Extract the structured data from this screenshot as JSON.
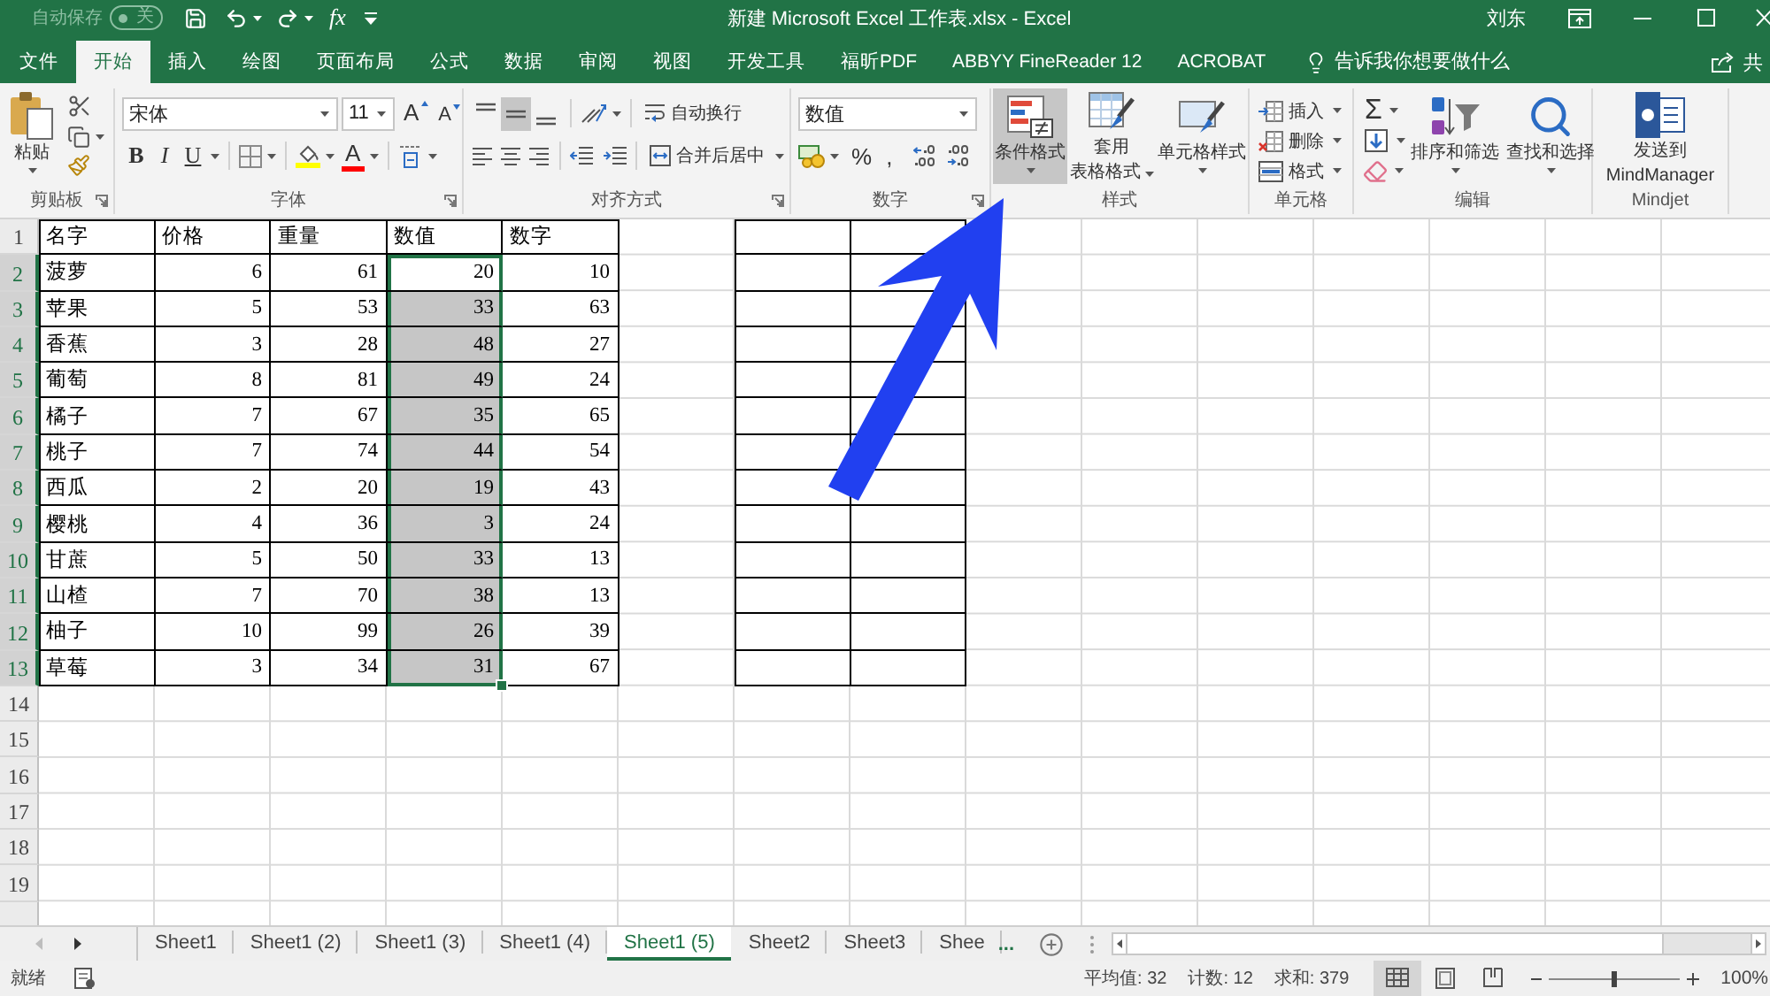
{
  "quick_access": {
    "autosave_label": "自动保存",
    "autosave_switch": {
      "label": "关",
      "on": false
    },
    "function_button": "fx"
  },
  "window": {
    "title": "新建 Microsoft Excel 工作表.xlsx - Excel",
    "user": "刘东"
  },
  "ribbon_tabs": [
    {
      "label": "文件",
      "selected": false
    },
    {
      "label": "开始",
      "selected": true
    },
    {
      "label": "插入",
      "selected": false
    },
    {
      "label": "绘图",
      "selected": false
    },
    {
      "label": "页面布局",
      "selected": false
    },
    {
      "label": "公式",
      "selected": false
    },
    {
      "label": "数据",
      "selected": false
    },
    {
      "label": "审阅",
      "selected": false
    },
    {
      "label": "视图",
      "selected": false
    },
    {
      "label": "开发工具",
      "selected": false
    },
    {
      "label": "福昕PDF",
      "selected": false
    },
    {
      "label": "ABBYY FineReader 12",
      "selected": false
    },
    {
      "label": "ACROBAT",
      "selected": false
    }
  ],
  "tell_me": {
    "placeholder": "告诉我你想要做什么"
  },
  "share": {
    "label": "共"
  },
  "ribbon": {
    "clipboard": {
      "label": "剪贴板",
      "paste": "粘贴"
    },
    "font": {
      "label": "字体",
      "font_name": "宋体",
      "font_size": "11",
      "grow": "A",
      "shrink": "A",
      "styles": [
        "B",
        "I",
        "U"
      ],
      "font_color": "A"
    },
    "alignment": {
      "label": "对齐方式",
      "vertical": [
        {
          "kind": "top",
          "selected": false
        },
        {
          "kind": "middle",
          "selected": true
        },
        {
          "kind": "bottom",
          "selected": false
        }
      ],
      "wrap_text": "自动换行",
      "merge_center": "合并后居中"
    },
    "number": {
      "label": "数字",
      "format": "数值",
      "percent": "%",
      "comma": ","
    },
    "styles": {
      "label": "样式",
      "buttons": [
        {
          "kind": "conditional",
          "lines": [
            "条件格式"
          ],
          "selected": true
        },
        {
          "kind": "table",
          "lines": [
            "套用",
            "表格格式"
          ],
          "selected": false
        },
        {
          "kind": "cell",
          "lines": [
            "单元格样式"
          ],
          "selected": false
        }
      ]
    },
    "cells": {
      "label": "单元格",
      "buttons": [
        {
          "kind": "insert",
          "label": "插入"
        },
        {
          "kind": "delete",
          "label": "删除"
        },
        {
          "kind": "format",
          "label": "格式"
        }
      ]
    },
    "editing": {
      "label": "编辑",
      "autosum": "Σ",
      "buttons": [
        {
          "kind": "sort",
          "label": "排序和筛选"
        },
        {
          "kind": "find",
          "label": "查找和选择"
        }
      ]
    },
    "mindjet": {
      "label": "Mindjet",
      "lines": [
        "发送到",
        "MindManager"
      ]
    }
  },
  "sheet": {
    "bordered_blank_range": true,
    "rows": [
      {
        "number": "1",
        "selected": false,
        "cells": [
          {
            "kind": "text",
            "text": "名字",
            "selected": false,
            "active": false
          },
          {
            "kind": "text",
            "text": "价格",
            "selected": false,
            "active": false
          },
          {
            "kind": "text",
            "text": "重量",
            "selected": false,
            "active": false
          },
          {
            "kind": "text",
            "text": "数值",
            "selected": false,
            "active": false
          },
          {
            "kind": "text",
            "text": "数字",
            "selected": false,
            "active": false
          }
        ]
      },
      {
        "number": "2",
        "selected": true,
        "cells": [
          {
            "kind": "text",
            "text": "菠萝",
            "selected": false,
            "active": false
          },
          {
            "kind": "number",
            "text": "6",
            "selected": false,
            "active": false
          },
          {
            "kind": "number",
            "text": "61",
            "selected": false,
            "active": false
          },
          {
            "kind": "number",
            "text": "20",
            "selected": true,
            "active": true
          },
          {
            "kind": "number",
            "text": "10",
            "selected": false,
            "active": false
          }
        ]
      },
      {
        "number": "3",
        "selected": true,
        "cells": [
          {
            "kind": "text",
            "text": "苹果",
            "selected": false,
            "active": false
          },
          {
            "kind": "number",
            "text": "5",
            "selected": false,
            "active": false
          },
          {
            "kind": "number",
            "text": "53",
            "selected": false,
            "active": false
          },
          {
            "kind": "number",
            "text": "33",
            "selected": true,
            "active": false
          },
          {
            "kind": "number",
            "text": "63",
            "selected": false,
            "active": false
          }
        ]
      },
      {
        "number": "4",
        "selected": true,
        "cells": [
          {
            "kind": "text",
            "text": "香蕉",
            "selected": false,
            "active": false
          },
          {
            "kind": "number",
            "text": "3",
            "selected": false,
            "active": false
          },
          {
            "kind": "number",
            "text": "28",
            "selected": false,
            "active": false
          },
          {
            "kind": "number",
            "text": "48",
            "selected": true,
            "active": false
          },
          {
            "kind": "number",
            "text": "27",
            "selected": false,
            "active": false
          }
        ]
      },
      {
        "number": "5",
        "selected": true,
        "cells": [
          {
            "kind": "text",
            "text": "葡萄",
            "selected": false,
            "active": false
          },
          {
            "kind": "number",
            "text": "8",
            "selected": false,
            "active": false
          },
          {
            "kind": "number",
            "text": "81",
            "selected": false,
            "active": false
          },
          {
            "kind": "number",
            "text": "49",
            "selected": true,
            "active": false
          },
          {
            "kind": "number",
            "text": "24",
            "selected": false,
            "active": false
          }
        ]
      },
      {
        "number": "6",
        "selected": true,
        "cells": [
          {
            "kind": "text",
            "text": "橘子",
            "selected": false,
            "active": false
          },
          {
            "kind": "number",
            "text": "7",
            "selected": false,
            "active": false
          },
          {
            "kind": "number",
            "text": "67",
            "selected": false,
            "active": false
          },
          {
            "kind": "number",
            "text": "35",
            "selected": true,
            "active": false
          },
          {
            "kind": "number",
            "text": "65",
            "selected": false,
            "active": false
          }
        ]
      },
      {
        "number": "7",
        "selected": true,
        "cells": [
          {
            "kind": "text",
            "text": "桃子",
            "selected": false,
            "active": false
          },
          {
            "kind": "number",
            "text": "7",
            "selected": false,
            "active": false
          },
          {
            "kind": "number",
            "text": "74",
            "selected": false,
            "active": false
          },
          {
            "kind": "number",
            "text": "44",
            "selected": true,
            "active": false
          },
          {
            "kind": "number",
            "text": "54",
            "selected": false,
            "active": false
          }
        ]
      },
      {
        "number": "8",
        "selected": true,
        "cells": [
          {
            "kind": "text",
            "text": "西瓜",
            "selected": false,
            "active": false
          },
          {
            "kind": "number",
            "text": "2",
            "selected": false,
            "active": false
          },
          {
            "kind": "number",
            "text": "20",
            "selected": false,
            "active": false
          },
          {
            "kind": "number",
            "text": "19",
            "selected": true,
            "active": false
          },
          {
            "kind": "number",
            "text": "43",
            "selected": false,
            "active": false
          }
        ]
      },
      {
        "number": "9",
        "selected": true,
        "cells": [
          {
            "kind": "text",
            "text": "樱桃",
            "selected": false,
            "active": false
          },
          {
            "kind": "number",
            "text": "4",
            "selected": false,
            "active": false
          },
          {
            "kind": "number",
            "text": "36",
            "selected": false,
            "active": false
          },
          {
            "kind": "number",
            "text": "3",
            "selected": true,
            "active": false
          },
          {
            "kind": "number",
            "text": "24",
            "selected": false,
            "active": false
          }
        ]
      },
      {
        "number": "10",
        "selected": true,
        "cells": [
          {
            "kind": "text",
            "text": "甘蔗",
            "selected": false,
            "active": false
          },
          {
            "kind": "number",
            "text": "5",
            "selected": false,
            "active": false
          },
          {
            "kind": "number",
            "text": "50",
            "selected": false,
            "active": false
          },
          {
            "kind": "number",
            "text": "33",
            "selected": true,
            "active": false
          },
          {
            "kind": "number",
            "text": "13",
            "selected": false,
            "active": false
          }
        ]
      },
      {
        "number": "11",
        "selected": true,
        "cells": [
          {
            "kind": "text",
            "text": "山楂",
            "selected": false,
            "active": false
          },
          {
            "kind": "number",
            "text": "7",
            "selected": false,
            "active": false
          },
          {
            "kind": "number",
            "text": "70",
            "selected": false,
            "active": false
          },
          {
            "kind": "number",
            "text": "38",
            "selected": true,
            "active": false
          },
          {
            "kind": "number",
            "text": "13",
            "selected": false,
            "active": false
          }
        ]
      },
      {
        "number": "12",
        "selected": true,
        "cells": [
          {
            "kind": "text",
            "text": "柚子",
            "selected": false,
            "active": false
          },
          {
            "kind": "number",
            "text": "10",
            "selected": false,
            "active": false
          },
          {
            "kind": "number",
            "text": "99",
            "selected": false,
            "active": false
          },
          {
            "kind": "number",
            "text": "26",
            "selected": true,
            "active": false
          },
          {
            "kind": "number",
            "text": "39",
            "selected": false,
            "active": false
          }
        ]
      },
      {
        "number": "13",
        "selected": true,
        "cells": [
          {
            "kind": "text",
            "text": "草莓",
            "selected": false,
            "active": false
          },
          {
            "kind": "number",
            "text": "3",
            "selected": false,
            "active": false
          },
          {
            "kind": "number",
            "text": "34",
            "selected": false,
            "active": false
          },
          {
            "kind": "number",
            "text": "31",
            "selected": true,
            "active": false
          },
          {
            "kind": "number",
            "text": "67",
            "selected": false,
            "active": false
          }
        ]
      },
      {
        "number": "14",
        "selected": false
      },
      {
        "number": "15",
        "selected": false
      },
      {
        "number": "16",
        "selected": false
      },
      {
        "number": "17",
        "selected": false
      },
      {
        "number": "18",
        "selected": false
      },
      {
        "number": "19",
        "selected": false
      }
    ]
  },
  "annotations": [
    {
      "kind": "arrow"
    }
  ],
  "sheet_tabs": {
    "tabs": [
      {
        "label": "Sheet1",
        "selected": false
      },
      {
        "label": "Sheet1 (2)",
        "selected": false
      },
      {
        "label": "Sheet1 (3)",
        "selected": false
      },
      {
        "label": "Sheet1 (4)",
        "selected": false
      },
      {
        "label": "Sheet1 (5)",
        "selected": true
      },
      {
        "label": "Sheet2",
        "selected": false
      },
      {
        "label": "Sheet3",
        "selected": false
      },
      {
        "label": "Shee",
        "selected": false
      }
    ],
    "overflow": "..."
  },
  "status_bar": {
    "status": "就绪",
    "stats": [
      "平均值: 32",
      "计数: 12",
      "求和: 379"
    ],
    "views": [
      {
        "kind": "normal",
        "selected": true
      },
      {
        "kind": "page_layout",
        "selected": false
      },
      {
        "kind": "page_break",
        "selected": false
      }
    ],
    "zoom": {
      "level": 0.5,
      "reading": "100%"
    }
  }
}
